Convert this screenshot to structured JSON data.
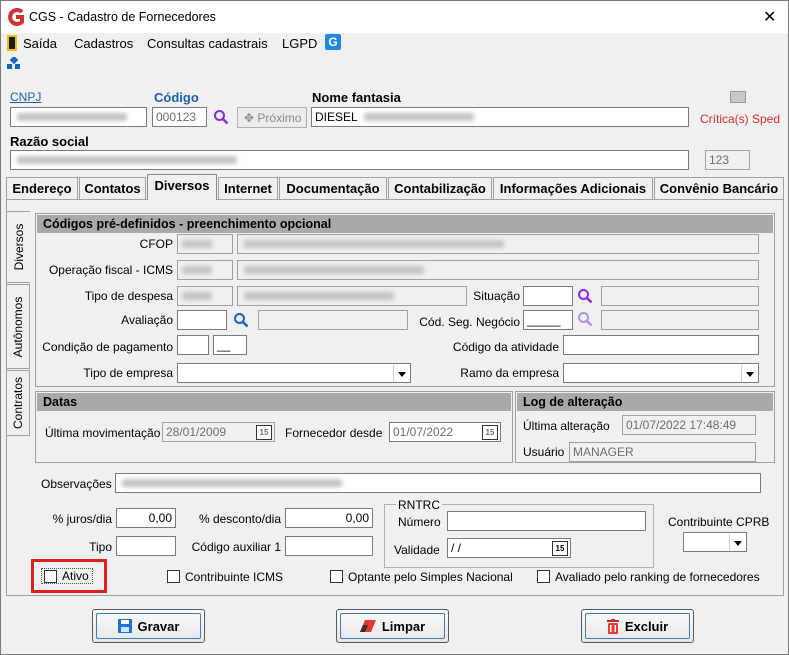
{
  "window": {
    "title": "CGS - Cadastro de Fornecedores",
    "close": "✕"
  },
  "menu": [
    "Saída",
    "Cadastros",
    "Consultas cadastrais",
    "LGPD"
  ],
  "header": {
    "cnpj_label": "CNPJ",
    "codigo_label": "Código",
    "codigo_value": "000123",
    "proximo_label": "Próximo",
    "nome_fantasia_label": "Nome fantasia",
    "nome_fantasia_value": "DIESEL",
    "critica_label": "Crítica(s) Sped",
    "razao_social_label": "Razão social",
    "razao_counter": "123"
  },
  "tabs": [
    "Endereço",
    "Contatos",
    "Diversos",
    "Internet",
    "Documentação",
    "Contabilização",
    "Informações Adicionais",
    "Convênio Bancário"
  ],
  "side_tabs": [
    "Diversos",
    "Autônomos",
    "Contratos"
  ],
  "codigos": {
    "title": "Códigos pré-definidos - preenchimento opcional",
    "cfop_label": "CFOP",
    "operacao_label": "Operação fiscal - ICMS",
    "tipo_despesa_label": "Tipo de despesa",
    "situacao_label": "Situação",
    "avaliacao_label": "Avaliação",
    "cod_seg_label": "Cód. Seg. Negócio",
    "cod_seg_value": "_____",
    "condicao_label": "Condição de pagamento",
    "condicao_value": "__",
    "codigo_atividade_label": "Código da atividade",
    "tipo_empresa_label": "Tipo de empresa",
    "ramo_label": "Ramo da empresa"
  },
  "datas": {
    "title": "Datas",
    "ultima_mov_label": "Última movimentação",
    "ultima_mov_value": "28/01/2009",
    "fornecedor_desde_label": "Fornecedor desde",
    "fornecedor_desde_value": "01/07/2022",
    "cal_label": "15"
  },
  "log": {
    "title": "Log de alteração",
    "ultima_alt_label": "Última alteração",
    "ultima_alt_value": "01/07/2022 17:48:49",
    "usuario_label": "Usuário",
    "usuario_value": "MANAGER"
  },
  "outros": {
    "observacoes_label": "Observações",
    "juros_label": "% juros/dia",
    "juros_value": "0,00",
    "desconto_label": "% desconto/dia",
    "desconto_value": "0,00",
    "tipo_label": "Tipo",
    "cod_aux_label": "Código auxiliar 1",
    "rntrc_label": "RNTRC",
    "numero_label": "Número",
    "validade_label": "Validade",
    "validade_value": "/ /",
    "contrib_cprb_label": "Contribuinte CPRB"
  },
  "checks": {
    "ativo": "Ativo",
    "contrib_icms": "Contribuinte ICMS",
    "optante": "Optante pelo Simples Nacional",
    "avaliado": "Avaliado pelo ranking de fornecedores"
  },
  "buttons": {
    "gravar": "Gravar",
    "limpar": "Limpar",
    "excluir": "Excluir"
  },
  "colors": {
    "accent_red": "#d32f2f",
    "highlight_box": "#e02020",
    "link_blue": "#1a5fb4",
    "panel_header": "#a9a9a9"
  }
}
